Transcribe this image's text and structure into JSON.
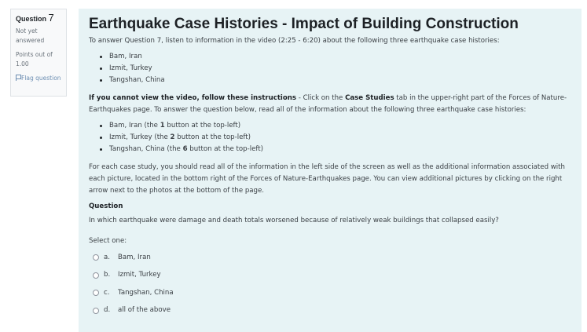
{
  "info": {
    "question_label": "Question",
    "question_number": "7",
    "state": "Not yet answered",
    "grade": "Points out of 1.00",
    "flag_label": "Flag question"
  },
  "content": {
    "title": "Earthquake Case Histories - Impact of Building Construction",
    "intro": "To answer Question 7, listen to information in the video (2:25 - 6:20) about the following three earthquake case histories:",
    "list1": [
      "Bam, Iran",
      "Izmit, Turkey",
      "Tangshan, China"
    ],
    "alt": {
      "bold_lead": "If you cannot view the video, follow these instructions",
      "text1": " - Click on the ",
      "bold_tab": "Case Studies",
      "text2": " tab in the upper-right part of the Forces of Nature-Earthquakes page. To answer the question below, read all of the information about the following three earthquake case histories:"
    },
    "list2": [
      {
        "pre": "Bam, Iran (the ",
        "bold": "1",
        "post": " button at the top-left)"
      },
      {
        "pre": "Izmit, Turkey (the ",
        "bold": "2",
        "post": " button at the top-left)"
      },
      {
        "pre": "Tangshan, China (the ",
        "bold": "6",
        "post": " button at the top-left)"
      }
    ],
    "para3": "For each case study, you should read all of the information in the left side of the screen as well as the additional information associated with each picture, located in the bottom right of the Forces of Nature-Earthquakes page. You can view additional pictures by clicking on the right arrow next to the photos at the bottom of the page.",
    "question_heading": "Question",
    "question_text": "In which earthquake were damage and death totals worsened because of relatively weak buildings that collapsed easily?",
    "select_prompt": "Select one:",
    "answers": [
      {
        "letter": "a.",
        "text": "Bam, Iran"
      },
      {
        "letter": "b.",
        "text": "Izmit, Turkey"
      },
      {
        "letter": "c.",
        "text": "Tangshan, China"
      },
      {
        "letter": "d.",
        "text": "all of the above"
      }
    ]
  }
}
